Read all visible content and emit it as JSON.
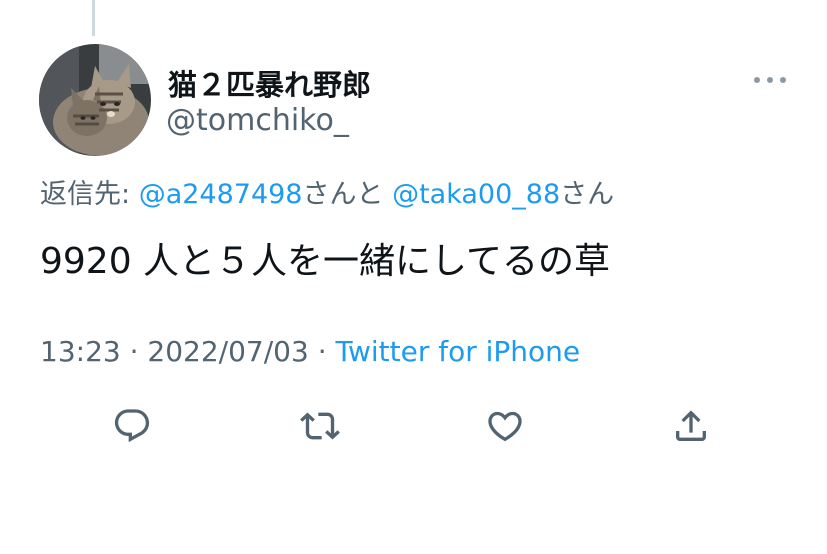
{
  "author": {
    "display_name": "猫２匹暴れ野郎",
    "handle": "@tomchiko_"
  },
  "reply_to": {
    "prefix": "返信先: ",
    "mention1": "@a2487498",
    "joiner": "さんと",
    "mention2": "@taka00_88",
    "suffix": "さん"
  },
  "tweet": {
    "text": "9920 人と５人を一緒にしてるの草"
  },
  "meta": {
    "time": "13:23",
    "separator1": " · ",
    "date": "2022/07/03",
    "separator2": " · ",
    "source": "Twitter for iPhone"
  },
  "icons": {
    "avatar": "cat-avatar",
    "more": "more-icon",
    "reply": "reply-icon",
    "retweet": "retweet-icon",
    "like": "like-icon",
    "share": "share-icon"
  },
  "colors": {
    "link": "#1d9bf0",
    "secondary_text": "#536471",
    "primary_text": "#0f1419"
  }
}
